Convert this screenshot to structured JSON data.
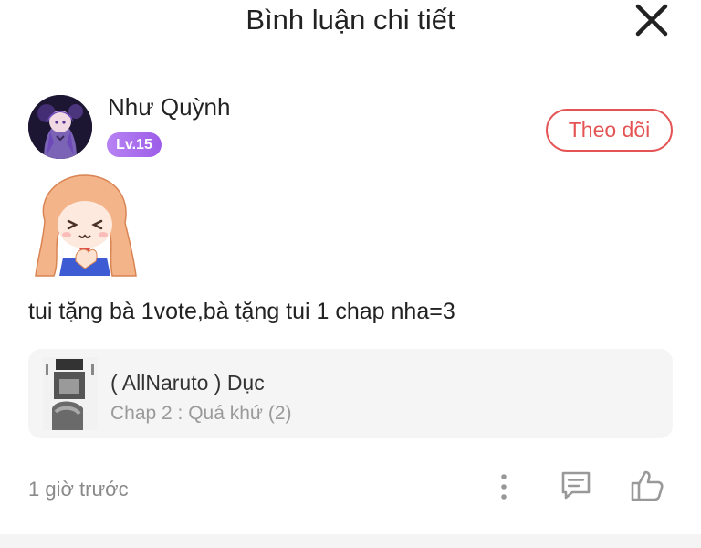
{
  "header": {
    "title": "Bình luận chi tiết"
  },
  "comment": {
    "user": {
      "name": "Như Quỳnh",
      "level": "Lv.15"
    },
    "follow_label": "Theo dõi",
    "text": "tui tặng bà 1vote,bà tặng tui 1 chap nha=3",
    "chapter_card": {
      "comic_title": "( AllNaruto ) Dục",
      "chapter": "Chap 2 : Quá khứ (2)"
    },
    "timestamp": "1 giờ trước"
  },
  "icons": {
    "close": "close-icon",
    "more": "more-vertical-icon",
    "reply": "comment-icon",
    "like": "thumbs-up-icon"
  },
  "colors": {
    "accent": "#e55454",
    "level_badge": "#a56ae9",
    "secondary_text": "#8a8a8a"
  }
}
